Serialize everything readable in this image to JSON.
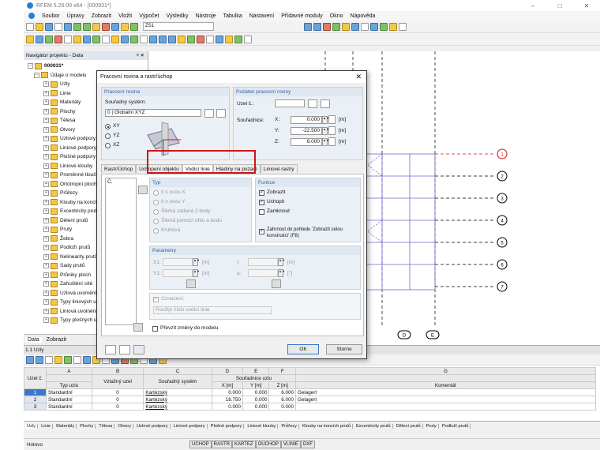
{
  "app": {
    "title": "RFEM 5.26.00 x64 - [000931*]",
    "wc": [
      "–",
      "□",
      "✕"
    ]
  },
  "menu": [
    "Soubor",
    "Úpravy",
    "Zobrazit",
    "Vložit",
    "Výpočet",
    "Výsledky",
    "Nástroje",
    "Tabulka",
    "Nastavení",
    "Přídavné moduly",
    "Okno",
    "Nápověda"
  ],
  "toolbar": {
    "combo": "ZS1"
  },
  "navigator": {
    "title": "Navigátor projektu - Data",
    "pin": "ᵠ ✕",
    "items": [
      {
        "t": "000931*",
        "lvl": 0
      },
      {
        "t": "Údaje o modelu",
        "lvl": 1
      },
      {
        "t": "Uzly",
        "lvl": 2
      },
      {
        "t": "Linie",
        "lvl": 2
      },
      {
        "t": "Materiály",
        "lvl": 2
      },
      {
        "t": "Plochy",
        "lvl": 2
      },
      {
        "t": "Tělesa",
        "lvl": 2
      },
      {
        "t": "Otvory",
        "lvl": 2
      },
      {
        "t": "Uzlové podpory",
        "lvl": 2
      },
      {
        "t": "Liniové podpory",
        "lvl": 2
      },
      {
        "t": "Plošné podpory",
        "lvl": 2
      },
      {
        "t": "Liniové klouby",
        "lvl": 2
      },
      {
        "t": "Proměnné tloušťky",
        "lvl": 2
      },
      {
        "t": "Ortotropní plochy",
        "lvl": 2
      },
      {
        "t": "Průřezy",
        "lvl": 2
      },
      {
        "t": "Klouby na koncích prutů",
        "lvl": 2
      },
      {
        "t": "Excentricity prutů",
        "lvl": 2
      },
      {
        "t": "Dělení prutů",
        "lvl": 2
      },
      {
        "t": "Pruty",
        "lvl": 2
      },
      {
        "t": "Žebra",
        "lvl": 2
      },
      {
        "t": "Podloží prutů",
        "lvl": 2
      },
      {
        "t": "Nelinearity prutů",
        "lvl": 2
      },
      {
        "t": "Sady prutů",
        "lvl": 2
      },
      {
        "t": "Průniky ploch",
        "lvl": 2
      },
      {
        "t": "Zahuštění sítě",
        "lvl": 2
      },
      {
        "t": "Uzlová uvolnění",
        "lvl": 2
      },
      {
        "t": "Typy liniových uvolnění",
        "lvl": 2
      },
      {
        "t": "Liniová uvolnění",
        "lvl": 2
      },
      {
        "t": "Typy plošných uvolnění",
        "lvl": 2
      }
    ],
    "tabs": [
      "Data",
      "Zobrazit"
    ]
  },
  "canvas": {
    "markers": [
      "1",
      "2",
      "3",
      "4",
      "5",
      "6",
      "7"
    ],
    "bottom_markers": [
      "D",
      "E"
    ]
  },
  "dialog": {
    "title": "Pracovní rovina a rastr/úchop",
    "close": "✕",
    "work_plane": {
      "title": "Pracovní rovina",
      "coord_label": "Souřadný systém:",
      "coord_value": "0 | Globální XYZ",
      "options": [
        "XY",
        "YZ",
        "XZ"
      ],
      "selected": "XY"
    },
    "origin": {
      "title": "Počátek pracovní roviny",
      "node_label": "Uzel č.:",
      "coords_label": "Souřadnice:",
      "fields": [
        {
          "axis": "X:",
          "value": "0.000",
          "unit": "[m]"
        },
        {
          "axis": "Y:",
          "value": "-22.500",
          "unit": "[m]"
        },
        {
          "axis": "Z:",
          "value": "6.000",
          "unit": "[m]"
        }
      ]
    },
    "tabs": [
      "Rastr/Úchop",
      "Uchopení objektu",
      "Vodicí linie",
      "Hladiny na pozadí",
      "Liniové rastry"
    ],
    "active_tab": "Vodicí linie",
    "list_header": "Č.",
    "type": {
      "title": "Typ",
      "options": [
        "II s osou X",
        "II s osou Y",
        "Šikmá zadaná 2 body",
        "Šikmá pomocí úhlu a bodu",
        "Kruhová"
      ]
    },
    "functions": {
      "title": "Funkce",
      "show": "Zobrazit",
      "snap": "Uchopit",
      "lock": "Zamknout",
      "include": "Zahrnout do pohledu 'Zobrazit celou konstrukci' (F8)"
    },
    "params": {
      "title": "Parametry",
      "x1": "X1:",
      "y1": "Y1:",
      "r": "r:",
      "a": "α:",
      "unit": "[m]",
      "deg": "[°]"
    },
    "label_caption": "Označení:",
    "label_value": "Použije číslo vodicí linie",
    "apply_model": "Převzít změny do modelu",
    "ok": "OK",
    "cancel": "Storno"
  },
  "table": {
    "title": "1.1 Uzly",
    "col_letters": [
      "A",
      "B",
      "C",
      "D",
      "E",
      "F",
      "G"
    ],
    "headers": [
      "Uzel č.",
      "Typ uzlu",
      "Vztažný uzel",
      "Souřadný systém",
      "X [m]",
      "Y [m]",
      "Z [m]",
      "Komentář"
    ],
    "coords_group": "Souřadnice uzlu",
    "rows": [
      [
        "1",
        "Standardní",
        "0",
        "Kartézský",
        "0.000",
        "0.000",
        "6.000",
        "Gelagert"
      ],
      [
        "2",
        "Standardní",
        "0",
        "Kartézský",
        "18.750",
        "0.000",
        "6.000",
        "Gelagert"
      ],
      [
        "3",
        "Standardní",
        "0",
        "Kartézský",
        "0.000",
        "0.000",
        "0.000",
        ""
      ]
    ]
  },
  "sheets": [
    "Uzly",
    "Linie",
    "Materiály",
    "Plochy",
    "Tělesa",
    "Otvory",
    "Uzlové podpory",
    "Liniové podpory",
    "Plošné podpory",
    "Liniové klouby",
    "Průřezy",
    "Klouby na koncích prutů",
    "Excentricity prutů",
    "Dělení prutů",
    "Pruty",
    "Podloží prutů"
  ],
  "status": {
    "text": "Hotovo",
    "flags": [
      "UCHOP",
      "RASTR",
      "KARTEZ",
      "OUCHOP",
      "VLINIE",
      "DXF"
    ]
  }
}
